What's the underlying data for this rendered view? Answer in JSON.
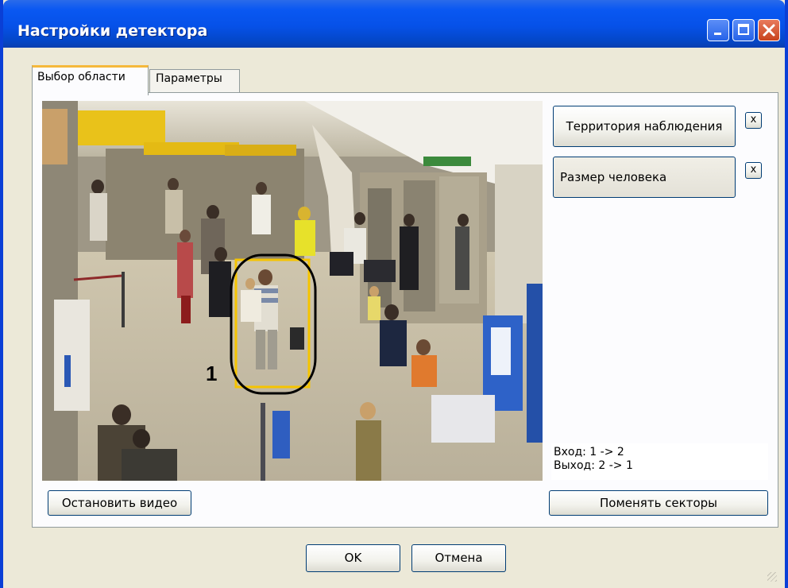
{
  "window": {
    "title": "Настройки детектора"
  },
  "tabs": [
    {
      "label": "Выбор области",
      "active": true
    },
    {
      "label": "Параметры",
      "active": false
    }
  ],
  "zones": {
    "observation_button": "Территория наблюдения",
    "person_size_button": "Размер человека",
    "remove_label": "x"
  },
  "info": {
    "entry": "Вход: 1 -> 2",
    "exit": "Выход: 2 -> 1"
  },
  "video": {
    "zone_number": "1",
    "marker_color": "#F5C400"
  },
  "buttons": {
    "stop_video": "Остановить видео",
    "swap_sectors": "Поменять секторы",
    "ok": "OK",
    "cancel": "Отмена"
  }
}
